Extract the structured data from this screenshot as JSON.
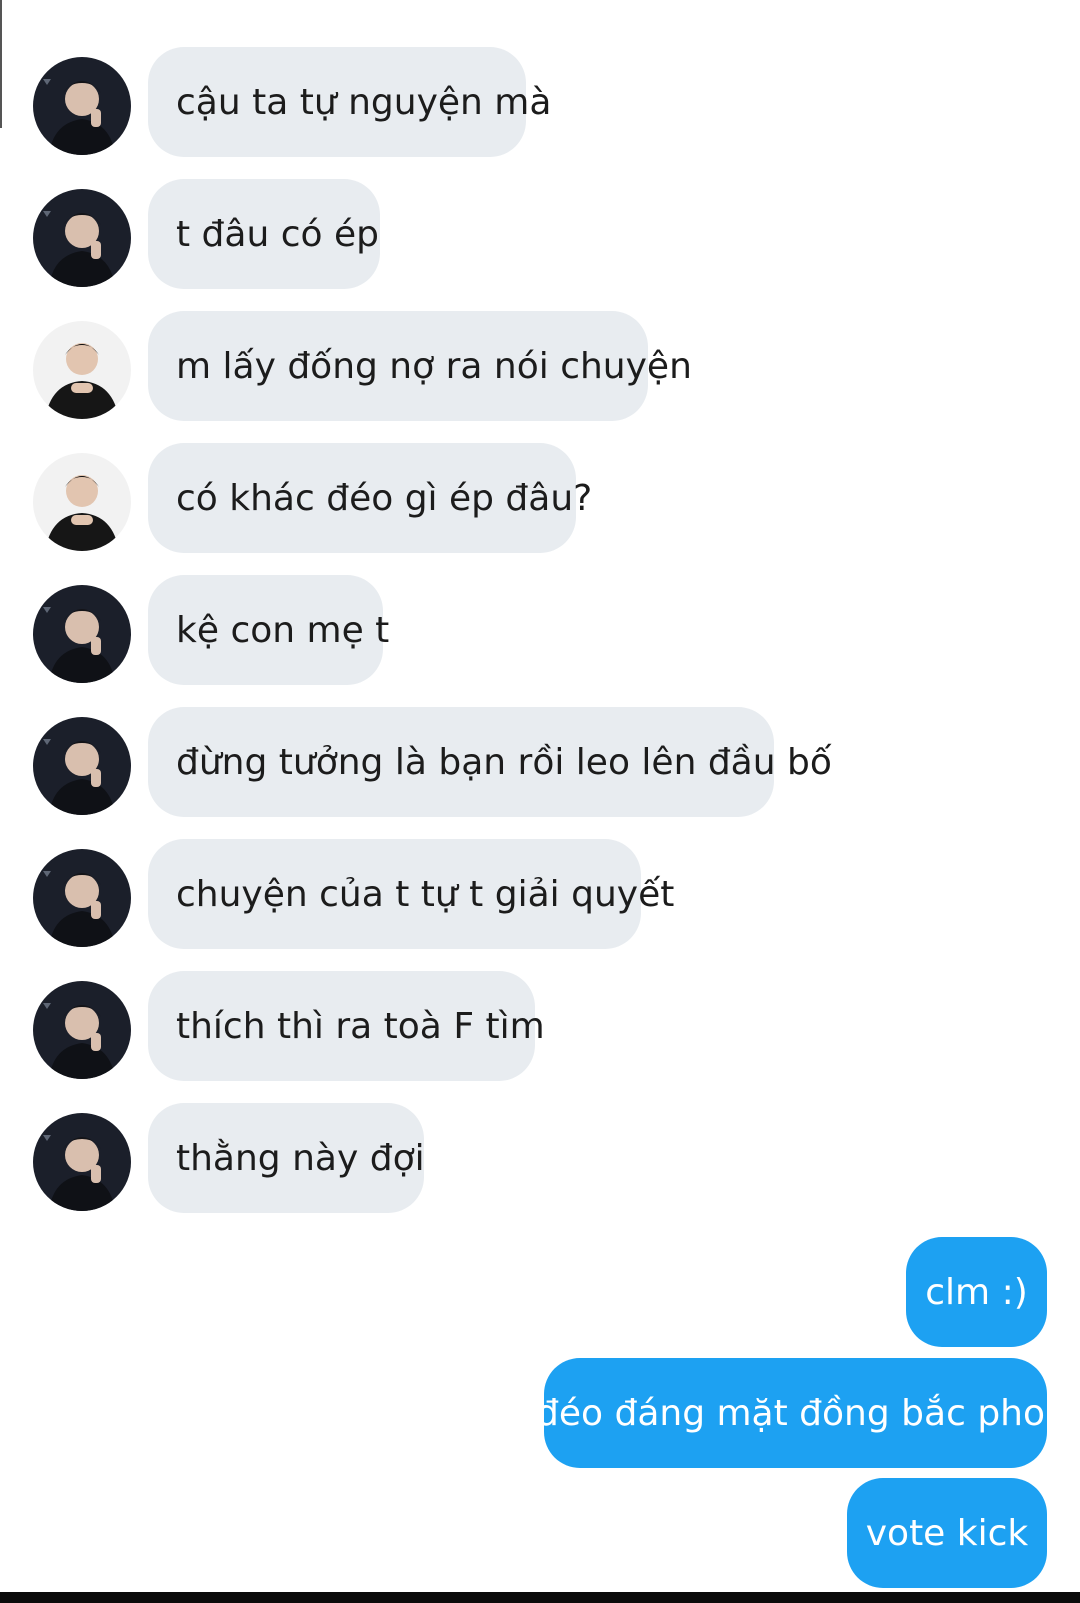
{
  "messages_in": [
    {
      "text": "cậu ta tự nguyện mà",
      "avatar": "dark-jacket-avatar"
    },
    {
      "text": "t đâu có ép",
      "avatar": "dark-jacket-avatar"
    },
    {
      "text": "m lấy đống nợ ra nói chuyện",
      "avatar": "light-background-avatar"
    },
    {
      "text": "có khác đéo gì ép đâu?",
      "avatar": "light-background-avatar"
    },
    {
      "text": "kệ con mẹ t",
      "avatar": "dark-jacket-avatar"
    },
    {
      "text": "đừng tưởng là bạn rồi leo lên đầu bố",
      "avatar": "dark-jacket-avatar"
    },
    {
      "text": "chuyện của t tự t giải quyết",
      "avatar": "dark-jacket-avatar"
    },
    {
      "text": "thích thì ra toà F tìm",
      "avatar": "dark-jacket-avatar"
    },
    {
      "text": "thằng này đợi",
      "avatar": "dark-jacket-avatar"
    }
  ],
  "messages_out": [
    {
      "text": "clm :)"
    },
    {
      "text": "đéo đáng mặt đồng bắc phoi"
    },
    {
      "text": "vote kick"
    }
  ],
  "colors": {
    "incoming_bubble": "#e8ecf0",
    "outgoing_bubble": "#1da1f2",
    "incoming_text": "#1c1c1c",
    "outgoing_text": "#ffffff"
  }
}
